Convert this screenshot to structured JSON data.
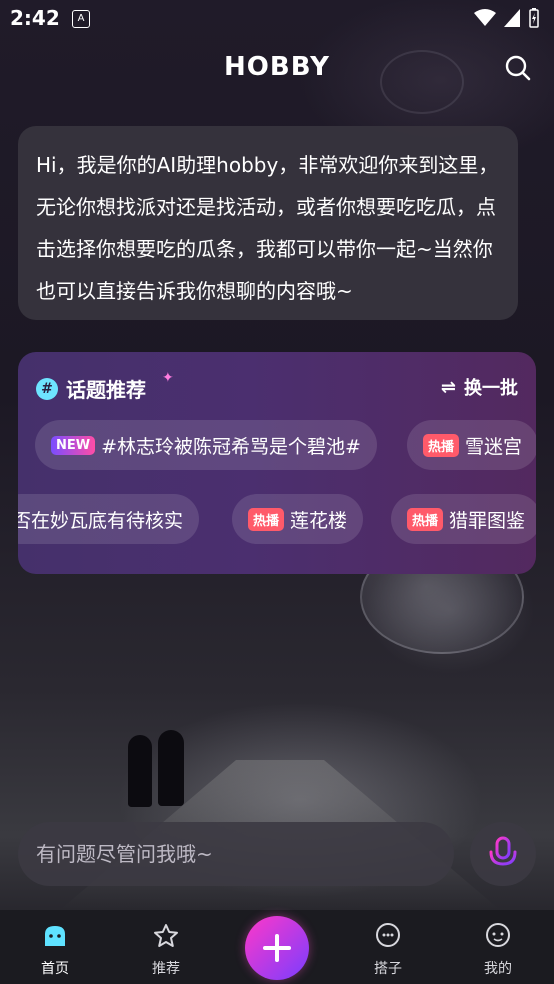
{
  "status_bar": {
    "time": "2:42",
    "nfc_icon": "A"
  },
  "header": {
    "brand": "HOBBY"
  },
  "assistant_message": "Hi，我是你的AI助理hobby，非常欢迎你来到这里，无论你想找派对还是找活动，或者你想要吃吃瓜，点击选择你想要吃的瓜条，我都可以带你一起~当然你也可以直接告诉我你想聊的内容哦~",
  "topics": {
    "title": "话题推荐",
    "refresh_label": "换一批",
    "row1": [
      {
        "badge": "NEW",
        "badge_type": "new",
        "text": "#林志玲被陈冠希骂是个碧池#"
      },
      {
        "badge": "热播",
        "badge_type": "hot",
        "text": "雪迷宫"
      }
    ],
    "row2": [
      {
        "badge": "",
        "badge_type": "none",
        "text": "否在妙瓦底有待核实"
      },
      {
        "badge": "热播",
        "badge_type": "hot",
        "text": "莲花楼"
      },
      {
        "badge": "热播",
        "badge_type": "hot",
        "text": "猎罪图鉴"
      }
    ]
  },
  "input": {
    "placeholder": "有问题尽管问我哦~"
  },
  "tabs": [
    {
      "label": "首页",
      "icon": "home-icon",
      "active": true
    },
    {
      "label": "推荐",
      "icon": "star-icon",
      "active": false
    },
    {
      "label": "搭子",
      "icon": "chat-icon",
      "active": false
    },
    {
      "label": "我的",
      "icon": "profile-icon",
      "active": false
    }
  ],
  "colors": {
    "accent_gradient_start": "#ff38c8",
    "accent_gradient_end": "#7a3dff",
    "hot_badge": "#ff5a6a",
    "hash_icon": "#6ee4ff"
  }
}
